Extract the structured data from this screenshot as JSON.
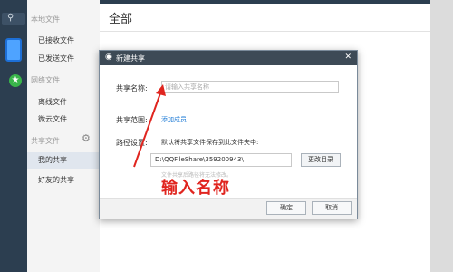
{
  "left_panel": {
    "local_section": "本地文件",
    "local_items": [
      "已接收文件",
      "已发送文件"
    ],
    "network_section": "网络文件",
    "network_items": [
      "离线文件",
      "微云文件"
    ],
    "share_section": "共享文件",
    "share_items": [
      "我的共享",
      "好友的共享"
    ]
  },
  "main": {
    "title": "全部"
  },
  "dialog": {
    "title": "新建共享",
    "name_label": "共享名称:",
    "name_placeholder": "请输入共享名称",
    "scope_label": "共享范围:",
    "add_member_link": "添加成员",
    "path_label": "路径设置:",
    "path_desc": "默认将共享文件保存到此文件夹中:",
    "path_value": "D:\\QQFileShare\\359200943\\",
    "change_dir_button": "更改目录",
    "path_note": "文件共享后路径将无法修改。",
    "ok_button": "确定",
    "cancel_button": "取消"
  },
  "annotation": {
    "text": "输入名称",
    "color": "#e0251f"
  },
  "colors": {
    "sidebar": "#2c3e50",
    "link": "#1e7bd6",
    "dialog_header": "#3d4a56"
  },
  "icons": [
    "search-icon",
    "phone-icon",
    "qq-icon",
    "close-icon",
    "gear-icon"
  ]
}
